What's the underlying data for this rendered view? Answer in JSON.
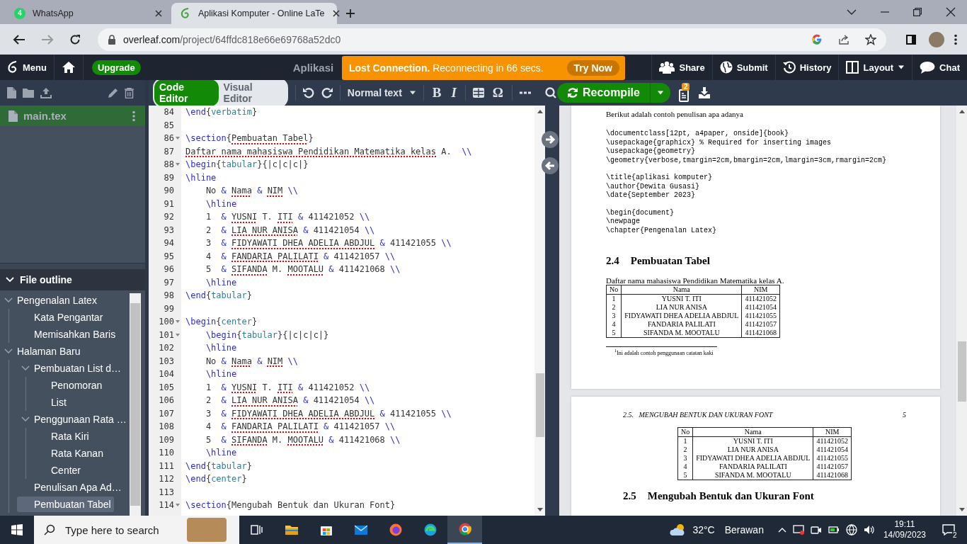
{
  "browser": {
    "tabs": [
      {
        "kind": "chat",
        "title": "WhatsApp",
        "badge": "4",
        "selected": false
      },
      {
        "kind": "leaf",
        "title": "Aplikasi Komputer - Online LaTe",
        "selected": true
      }
    ],
    "url_host": "overleaf.com",
    "url_path": "/project/64ffdc818e66e69768a52dc0"
  },
  "header": {
    "menu": "Menu",
    "upgrade": "Upgrade",
    "project_title": "Aplikasi",
    "banner": {
      "message": "**Lost Connection.** Reconnecting in 66 secs.",
      "action": "Try Now"
    },
    "actions": [
      {
        "kind": "share",
        "label": "Share",
        "dropdown": false
      },
      {
        "kind": "submit",
        "label": "Submit",
        "dropdown": false
      },
      {
        "kind": "history",
        "label": "History",
        "dropdown": false
      },
      {
        "kind": "layout",
        "label": "Layout",
        "dropdown": true
      },
      {
        "kind": "chat",
        "label": "Chat",
        "dropdown": false
      }
    ]
  },
  "files": [
    {
      "name": "main.tex",
      "selected": true
    }
  ],
  "outline": {
    "title": "File outline",
    "expanded": true,
    "items": [
      {
        "label": "Pengenalan Latex",
        "selected": false,
        "expanded": true,
        "children": [
          {
            "label": "Kata Pengantar",
            "selected": false
          },
          {
            "label": "Memisahkan Baris",
            "selected": false
          }
        ]
      },
      {
        "label": "Halaman Baru",
        "selected": false,
        "expanded": true,
        "children": [
          {
            "label": "Pembuatan List d…",
            "selected": false,
            "expanded": true,
            "children": [
              {
                "label": "Penomoran",
                "selected": false
              },
              {
                "label": "List",
                "selected": false
              }
            ]
          },
          {
            "label": "Penggunaan Rata …",
            "selected": false,
            "expanded": true,
            "children": [
              {
                "label": "Rata Kiri",
                "selected": false
              },
              {
                "label": "Rata Kanan",
                "selected": false
              },
              {
                "label": "Center",
                "selected": false
              }
            ]
          },
          {
            "label": "Penulisan Apa Ad…",
            "selected": false
          },
          {
            "label": "Pembuatan Tabel",
            "selected": true
          }
        ]
      }
    ]
  },
  "editor_toolbar": {
    "modes": [
      {
        "label": "Code Editor",
        "selected": true
      },
      {
        "label": "Visual Editor",
        "selected": false
      }
    ],
    "text_style": "Normal text",
    "format_buttons": [
      {
        "kind": "bold",
        "label": "B"
      },
      {
        "kind": "italic",
        "label": "I"
      }
    ],
    "symbol_button": "Ω",
    "recompile": "Recompile",
    "logs_badge": "2"
  },
  "code_lines": [
    {
      "number": "84",
      "foldable": false,
      "segments": [
        {
          "kind": "cmd",
          "text": "\\end"
        },
        {
          "kind": "txt",
          "text": "{"
        },
        {
          "kind": "arg",
          "text": "verbatim"
        },
        {
          "kind": "txt",
          "text": "}"
        }
      ]
    },
    {
      "number": "85",
      "foldable": false
    },
    {
      "number": "86",
      "foldable": true,
      "segments": [
        {
          "kind": "cmd",
          "text": "\\section"
        },
        {
          "kind": "txt",
          "text": "{"
        },
        {
          "kind": "typo",
          "text": "Pembuatan Tabel"
        },
        {
          "kind": "txt",
          "text": "}"
        }
      ]
    },
    {
      "number": "87",
      "foldable": false,
      "segments": [
        {
          "kind": "typo",
          "text": "Daftar nama mahasiswa Pendidikan Matematika kelas"
        },
        {
          "kind": "txt",
          "text": " A.  "
        },
        {
          "kind": "cmd",
          "text": "\\\\"
        }
      ]
    },
    {
      "number": "88",
      "foldable": true,
      "segments": [
        {
          "kind": "cmd",
          "text": "\\begin"
        },
        {
          "kind": "txt",
          "text": "{"
        },
        {
          "kind": "arg",
          "text": "tabular"
        },
        {
          "kind": "txt",
          "text": "}{|c|c|c|}"
        }
      ]
    },
    {
      "number": "89",
      "foldable": false,
      "segments": [
        {
          "kind": "cmd",
          "text": "\\hline"
        }
      ]
    },
    {
      "number": "90",
      "foldable": false,
      "segments": [
        {
          "kind": "txt",
          "text": "    No "
        },
        {
          "kind": "cmd",
          "text": "& "
        },
        {
          "kind": "typo",
          "text": "Nama"
        },
        {
          "kind": "cmd",
          "text": " & "
        },
        {
          "kind": "typo",
          "text": "NIM"
        },
        {
          "kind": "cmd",
          "text": " \\\\"
        }
      ]
    },
    {
      "number": "91",
      "foldable": false,
      "segments": [
        {
          "kind": "cmd",
          "text": "    \\hline"
        }
      ]
    },
    {
      "number": "92",
      "foldable": false,
      "segments": [
        {
          "kind": "txt",
          "text": "    1  "
        },
        {
          "kind": "cmd",
          "text": "& "
        },
        {
          "kind": "typo",
          "text": "YUSNI"
        },
        {
          "kind": "txt",
          "text": " T. "
        },
        {
          "kind": "typo",
          "text": "ITI"
        },
        {
          "kind": "cmd",
          "text": " & "
        },
        {
          "kind": "txt",
          "text": "411421052"
        },
        {
          "kind": "cmd",
          "text": " \\\\"
        }
      ]
    },
    {
      "number": "93",
      "foldable": false,
      "segments": [
        {
          "kind": "txt",
          "text": "    2  "
        },
        {
          "kind": "cmd",
          "text": "& "
        },
        {
          "kind": "typo",
          "text": "LIA NUR ANISA"
        },
        {
          "kind": "cmd",
          "text": " & "
        },
        {
          "kind": "txt",
          "text": "411421054"
        },
        {
          "kind": "cmd",
          "text": " \\\\"
        }
      ]
    },
    {
      "number": "94",
      "foldable": false,
      "segments": [
        {
          "kind": "txt",
          "text": "    3  "
        },
        {
          "kind": "cmd",
          "text": "& "
        },
        {
          "kind": "typo",
          "text": "FIDYAWATI DHEA ADELIA ABDJUL"
        },
        {
          "kind": "cmd",
          "text": " & "
        },
        {
          "kind": "txt",
          "text": "411421055"
        },
        {
          "kind": "cmd",
          "text": " \\\\"
        }
      ]
    },
    {
      "number": "95",
      "foldable": false,
      "segments": [
        {
          "kind": "txt",
          "text": "    4  "
        },
        {
          "kind": "cmd",
          "text": "& "
        },
        {
          "kind": "typo",
          "text": "FANDARIA PALILATI"
        },
        {
          "kind": "cmd",
          "text": " & "
        },
        {
          "kind": "txt",
          "text": "411421057"
        },
        {
          "kind": "cmd",
          "text": " \\\\"
        }
      ]
    },
    {
      "number": "96",
      "foldable": false,
      "segments": [
        {
          "kind": "txt",
          "text": "    5  "
        },
        {
          "kind": "cmd",
          "text": "& "
        },
        {
          "kind": "typo",
          "text": "SIFANDA"
        },
        {
          "kind": "txt",
          "text": " M. "
        },
        {
          "kind": "typo",
          "text": "MOOTALU"
        },
        {
          "kind": "cmd",
          "text": " & "
        },
        {
          "kind": "txt",
          "text": "411421068"
        },
        {
          "kind": "cmd",
          "text": " \\\\"
        }
      ]
    },
    {
      "number": "97",
      "foldable": false,
      "segments": [
        {
          "kind": "cmd",
          "text": "    \\hline"
        }
      ]
    },
    {
      "number": "98",
      "foldable": false,
      "segments": [
        {
          "kind": "cmd",
          "text": "\\end"
        },
        {
          "kind": "txt",
          "text": "{"
        },
        {
          "kind": "arg",
          "text": "tabular"
        },
        {
          "kind": "txt",
          "text": "}"
        }
      ]
    },
    {
      "number": "99",
      "foldable": false
    },
    {
      "number": "100",
      "foldable": true,
      "segments": [
        {
          "kind": "cmd",
          "text": "\\begin"
        },
        {
          "kind": "txt",
          "text": "{"
        },
        {
          "kind": "arg",
          "text": "center"
        },
        {
          "kind": "txt",
          "text": "}"
        }
      ]
    },
    {
      "number": "101",
      "foldable": true,
      "segments": [
        {
          "kind": "cmd",
          "text": "    \\begin"
        },
        {
          "kind": "txt",
          "text": "{"
        },
        {
          "kind": "arg",
          "text": "tabular"
        },
        {
          "kind": "txt",
          "text": "}{|c|c|c|}"
        }
      ]
    },
    {
      "number": "102",
      "foldable": false,
      "segments": [
        {
          "kind": "cmd",
          "text": "    \\hline"
        }
      ]
    },
    {
      "number": "103",
      "foldable": false,
      "segments": [
        {
          "kind": "txt",
          "text": "    No "
        },
        {
          "kind": "cmd",
          "text": "& "
        },
        {
          "kind": "typo",
          "text": "Nama"
        },
        {
          "kind": "cmd",
          "text": " & "
        },
        {
          "kind": "typo",
          "text": "NIM"
        },
        {
          "kind": "cmd",
          "text": " \\\\"
        }
      ]
    },
    {
      "number": "104",
      "foldable": false,
      "segments": [
        {
          "kind": "cmd",
          "text": "    \\hline"
        }
      ]
    },
    {
      "number": "105",
      "foldable": false,
      "segments": [
        {
          "kind": "txt",
          "text": "    1  "
        },
        {
          "kind": "cmd",
          "text": "& "
        },
        {
          "kind": "typo",
          "text": "YUSNI"
        },
        {
          "kind": "txt",
          "text": " T. "
        },
        {
          "kind": "typo",
          "text": "ITI"
        },
        {
          "kind": "cmd",
          "text": " & "
        },
        {
          "kind": "txt",
          "text": "411421052"
        },
        {
          "kind": "cmd",
          "text": " \\\\"
        }
      ]
    },
    {
      "number": "106",
      "foldable": false,
      "segments": [
        {
          "kind": "txt",
          "text": "    2  "
        },
        {
          "kind": "cmd",
          "text": "& "
        },
        {
          "kind": "typo",
          "text": "LIA NUR ANISA"
        },
        {
          "kind": "cmd",
          "text": " & "
        },
        {
          "kind": "txt",
          "text": "411421054"
        },
        {
          "kind": "cmd",
          "text": " \\\\"
        }
      ]
    },
    {
      "number": "107",
      "foldable": false,
      "segments": [
        {
          "kind": "txt",
          "text": "    3  "
        },
        {
          "kind": "cmd",
          "text": "& "
        },
        {
          "kind": "typo",
          "text": "FIDYAWATI DHEA ADELIA ABDJUL"
        },
        {
          "kind": "cmd",
          "text": " & "
        },
        {
          "kind": "txt",
          "text": "411421055"
        },
        {
          "kind": "cmd",
          "text": " \\\\"
        }
      ]
    },
    {
      "number": "108",
      "foldable": false,
      "segments": [
        {
          "kind": "txt",
          "text": "    4  "
        },
        {
          "kind": "cmd",
          "text": "& "
        },
        {
          "kind": "typo",
          "text": "FANDARIA PALILATI"
        },
        {
          "kind": "cmd",
          "text": " & "
        },
        {
          "kind": "txt",
          "text": "411421057"
        },
        {
          "kind": "cmd",
          "text": " \\\\"
        }
      ]
    },
    {
      "number": "109",
      "foldable": false,
      "segments": [
        {
          "kind": "txt",
          "text": "    5  "
        },
        {
          "kind": "cmd",
          "text": "& "
        },
        {
          "kind": "typo",
          "text": "SIFANDA"
        },
        {
          "kind": "txt",
          "text": " M. "
        },
        {
          "kind": "typo",
          "text": "MOOTALU"
        },
        {
          "kind": "cmd",
          "text": " & "
        },
        {
          "kind": "txt",
          "text": "411421068"
        },
        {
          "kind": "cmd",
          "text": " \\\\"
        }
      ]
    },
    {
      "number": "110",
      "foldable": false,
      "segments": [
        {
          "kind": "cmd",
          "text": "    \\hline"
        }
      ]
    },
    {
      "number": "111",
      "foldable": false,
      "segments": [
        {
          "kind": "cmd",
          "text": "\\end"
        },
        {
          "kind": "txt",
          "text": "{"
        },
        {
          "kind": "arg",
          "text": "tabular"
        },
        {
          "kind": "txt",
          "text": "}"
        }
      ]
    },
    {
      "number": "112",
      "foldable": false,
      "segments": [
        {
          "kind": "cmd",
          "text": "\\end"
        },
        {
          "kind": "txt",
          "text": "{"
        },
        {
          "kind": "arg",
          "text": "center"
        },
        {
          "kind": "txt",
          "text": "}"
        }
      ]
    },
    {
      "number": "113",
      "foldable": false
    },
    {
      "number": "114",
      "foldable": true,
      "segments": [
        {
          "kind": "cmd",
          "text": "\\section"
        },
        {
          "kind": "txt",
          "text": "{Mengubah Bentuk dan Ukuran Font}"
        }
      ]
    }
  ],
  "preview": {
    "page_1": {
      "intro": "Berikut adalah contoh penulisan apa adanya",
      "verbatim_blocks": [
        [
          "\\documentclass[12pt, a4paper, onside]{book}",
          "\\usepackage{graphicx} % Required for inserting images",
          "\\usepackage{geometry}",
          "\\geometry{verbose,tmargin=2cm,bmargin=2cm,lmargin=3cm,rmargin=2cm}"
        ],
        [
          "\\title{aplikasi komputer}",
          "\\author{Dewita Gusasi}",
          "\\date{September 2023}"
        ],
        [
          "\\begin{document}",
          "\\newpage",
          "\\chapter{Pengenalan Latex}"
        ]
      ],
      "section_number": "2.4",
      "section_title": "Pembuatan Tabel",
      "paragraph": "Daftar nama mahasiswa Pendidikan Matematika kelas A.",
      "table": {
        "columns": [
          "No",
          "Nama",
          "NIM"
        ],
        "rows": [
          [
            "1",
            "YUSNI T. ITI",
            "411421052"
          ],
          [
            "2",
            "LIA NUR ANISA",
            "411421054"
          ],
          [
            "3",
            "FIDYAWATI DHEA ADELIA ABDJUL",
            "411421055"
          ],
          [
            "4",
            "FANDARIA PALILATI",
            "411421057"
          ],
          [
            "5",
            "SIFANDA M. MOOTALU",
            "411421068"
          ]
        ]
      },
      "footnote": "$^{1}$Ini adalah contoh penggunaan catatan kaki"
    },
    "page_2": {
      "running_head": "2.5.   MENGUBAH BENTUK DAN UKURAN FONT",
      "page_number": "5",
      "table": {
        "columns": [
          "No",
          "Nama",
          "NIM"
        ],
        "rows": [
          [
            "1",
            "YUSNI T. ITI",
            "411421052"
          ],
          [
            "2",
            "LIA NUR ANISA",
            "411421054"
          ],
          [
            "3",
            "FIDYAWATI DHEA ADELIA ABDJUL",
            "411421055"
          ],
          [
            "4",
            "FANDARIA PALILATI",
            "411421057"
          ],
          [
            "5",
            "SIFANDA M. MOOTALU",
            "411421068"
          ]
        ]
      },
      "section_number": "2.5",
      "section_title": "Mengubah Bentuk dan Ukuran Font"
    }
  },
  "taskbar": {
    "search_placeholder": "Type here to search",
    "apps": [
      {
        "kind": "taskview",
        "active": false
      },
      {
        "kind": "files",
        "active": false
      },
      {
        "kind": "store",
        "active": false
      },
      {
        "kind": "mail",
        "active": false
      },
      {
        "kind": "firefox",
        "active": false
      },
      {
        "kind": "edge",
        "active": false
      },
      {
        "kind": "chrome",
        "active": true
      }
    ],
    "temperature": "32°C",
    "weather": "Berawan",
    "time": "19:11",
    "date": "14/09/2023",
    "notifications": "2"
  }
}
